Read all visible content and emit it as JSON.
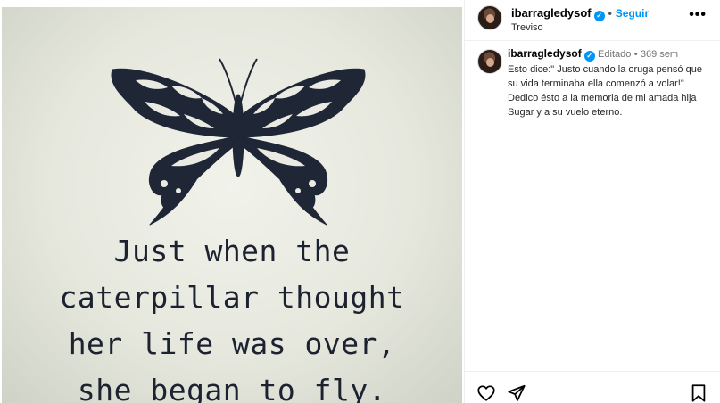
{
  "post": {
    "image": {
      "quote_lines": [
        "Just when the",
        "caterpillar thought",
        "her life was over,",
        "she began to fly."
      ],
      "art": "butterfly-illustration"
    },
    "header": {
      "username": "ibarragledysof",
      "verified_icon": "verified-badge-icon",
      "separator": "•",
      "follow_label": "Seguir",
      "location": "Treviso",
      "more_icon": "more-options-icon"
    },
    "caption": {
      "username": "ibarragledysof",
      "edited": "Editado",
      "separator": "•",
      "time": "369 sem",
      "text_lines": [
        "Esto dice:\" Justo cuando la oruga pensó que su vida terminaba ella comenzó a volar!\"",
        "Dedico ésto a la memoria de mi amada hija Sugar y a su vuelo eterno."
      ]
    },
    "actions": {
      "like_icon": "heart-icon",
      "share_icon": "send-icon",
      "save_icon": "bookmark-icon"
    }
  },
  "colors": {
    "accent": "#0095f6",
    "border": "#efefef",
    "muted": "#737373",
    "quote_ink": "#1c2230"
  }
}
